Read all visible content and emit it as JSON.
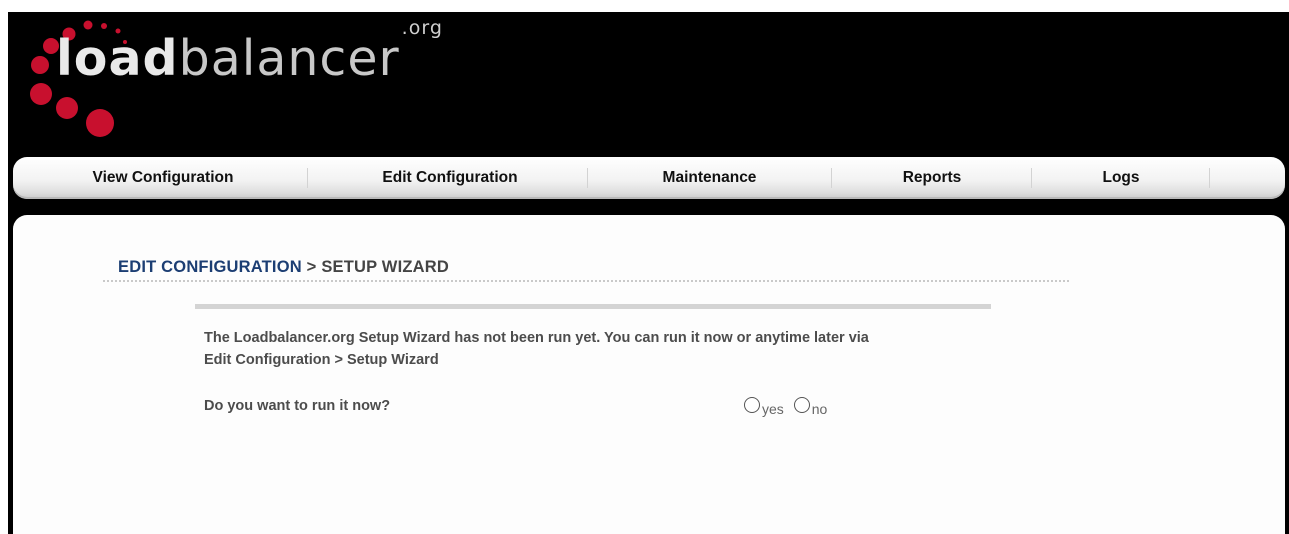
{
  "logo": {
    "text_bold": "load",
    "text_light": "balancer",
    "superscript": ".org"
  },
  "colors": {
    "logo_red": "#c8102e",
    "title_blue": "#1c3e73",
    "body_text": "#4c4c4c",
    "header_bg": "#000000"
  },
  "nav": {
    "items": [
      {
        "label": "View Configuration"
      },
      {
        "label": "Edit Configuration"
      },
      {
        "label": "Maintenance"
      },
      {
        "label": "Reports"
      },
      {
        "label": "Logs"
      }
    ]
  },
  "page": {
    "title_crumb": "EDIT CONFIGURATION",
    "title_sep": ">",
    "title_current": "SETUP WIZARD",
    "message_line1": "The Loadbalancer.org Setup Wizard has not been run yet. You can run it now or anytime later via",
    "message_line2": "Edit Configuration > Setup Wizard",
    "question": "Do you want to run it now?",
    "radio_yes": "yes",
    "radio_no": "no"
  }
}
